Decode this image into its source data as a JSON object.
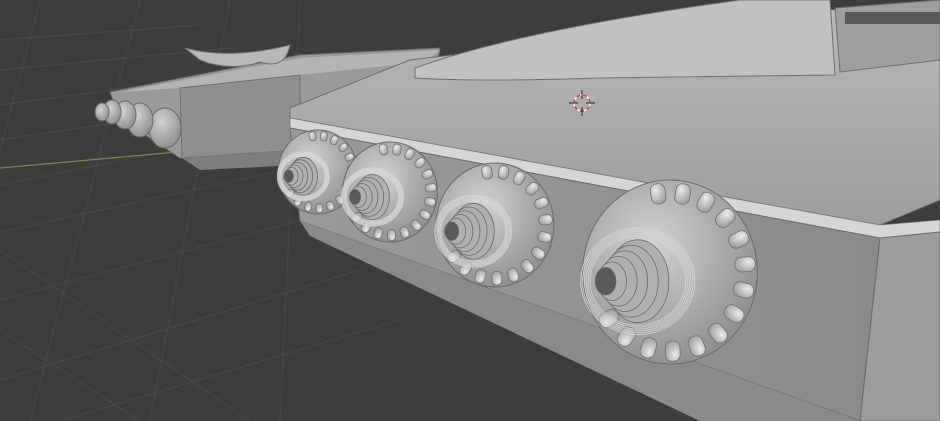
{
  "viewport": {
    "background": "#3d3d3d",
    "grid_color": "#4a4a4a",
    "x_axis_color": "#7a8a44",
    "object_base_color": "#a6a6a6"
  },
  "cursor": {
    "icon": "3d-cursor-icon",
    "color": "#d04040"
  },
  "engines": {
    "icon": "engine-nozzle-icon",
    "count_near_hull": 4,
    "count_far_hull": 5
  }
}
